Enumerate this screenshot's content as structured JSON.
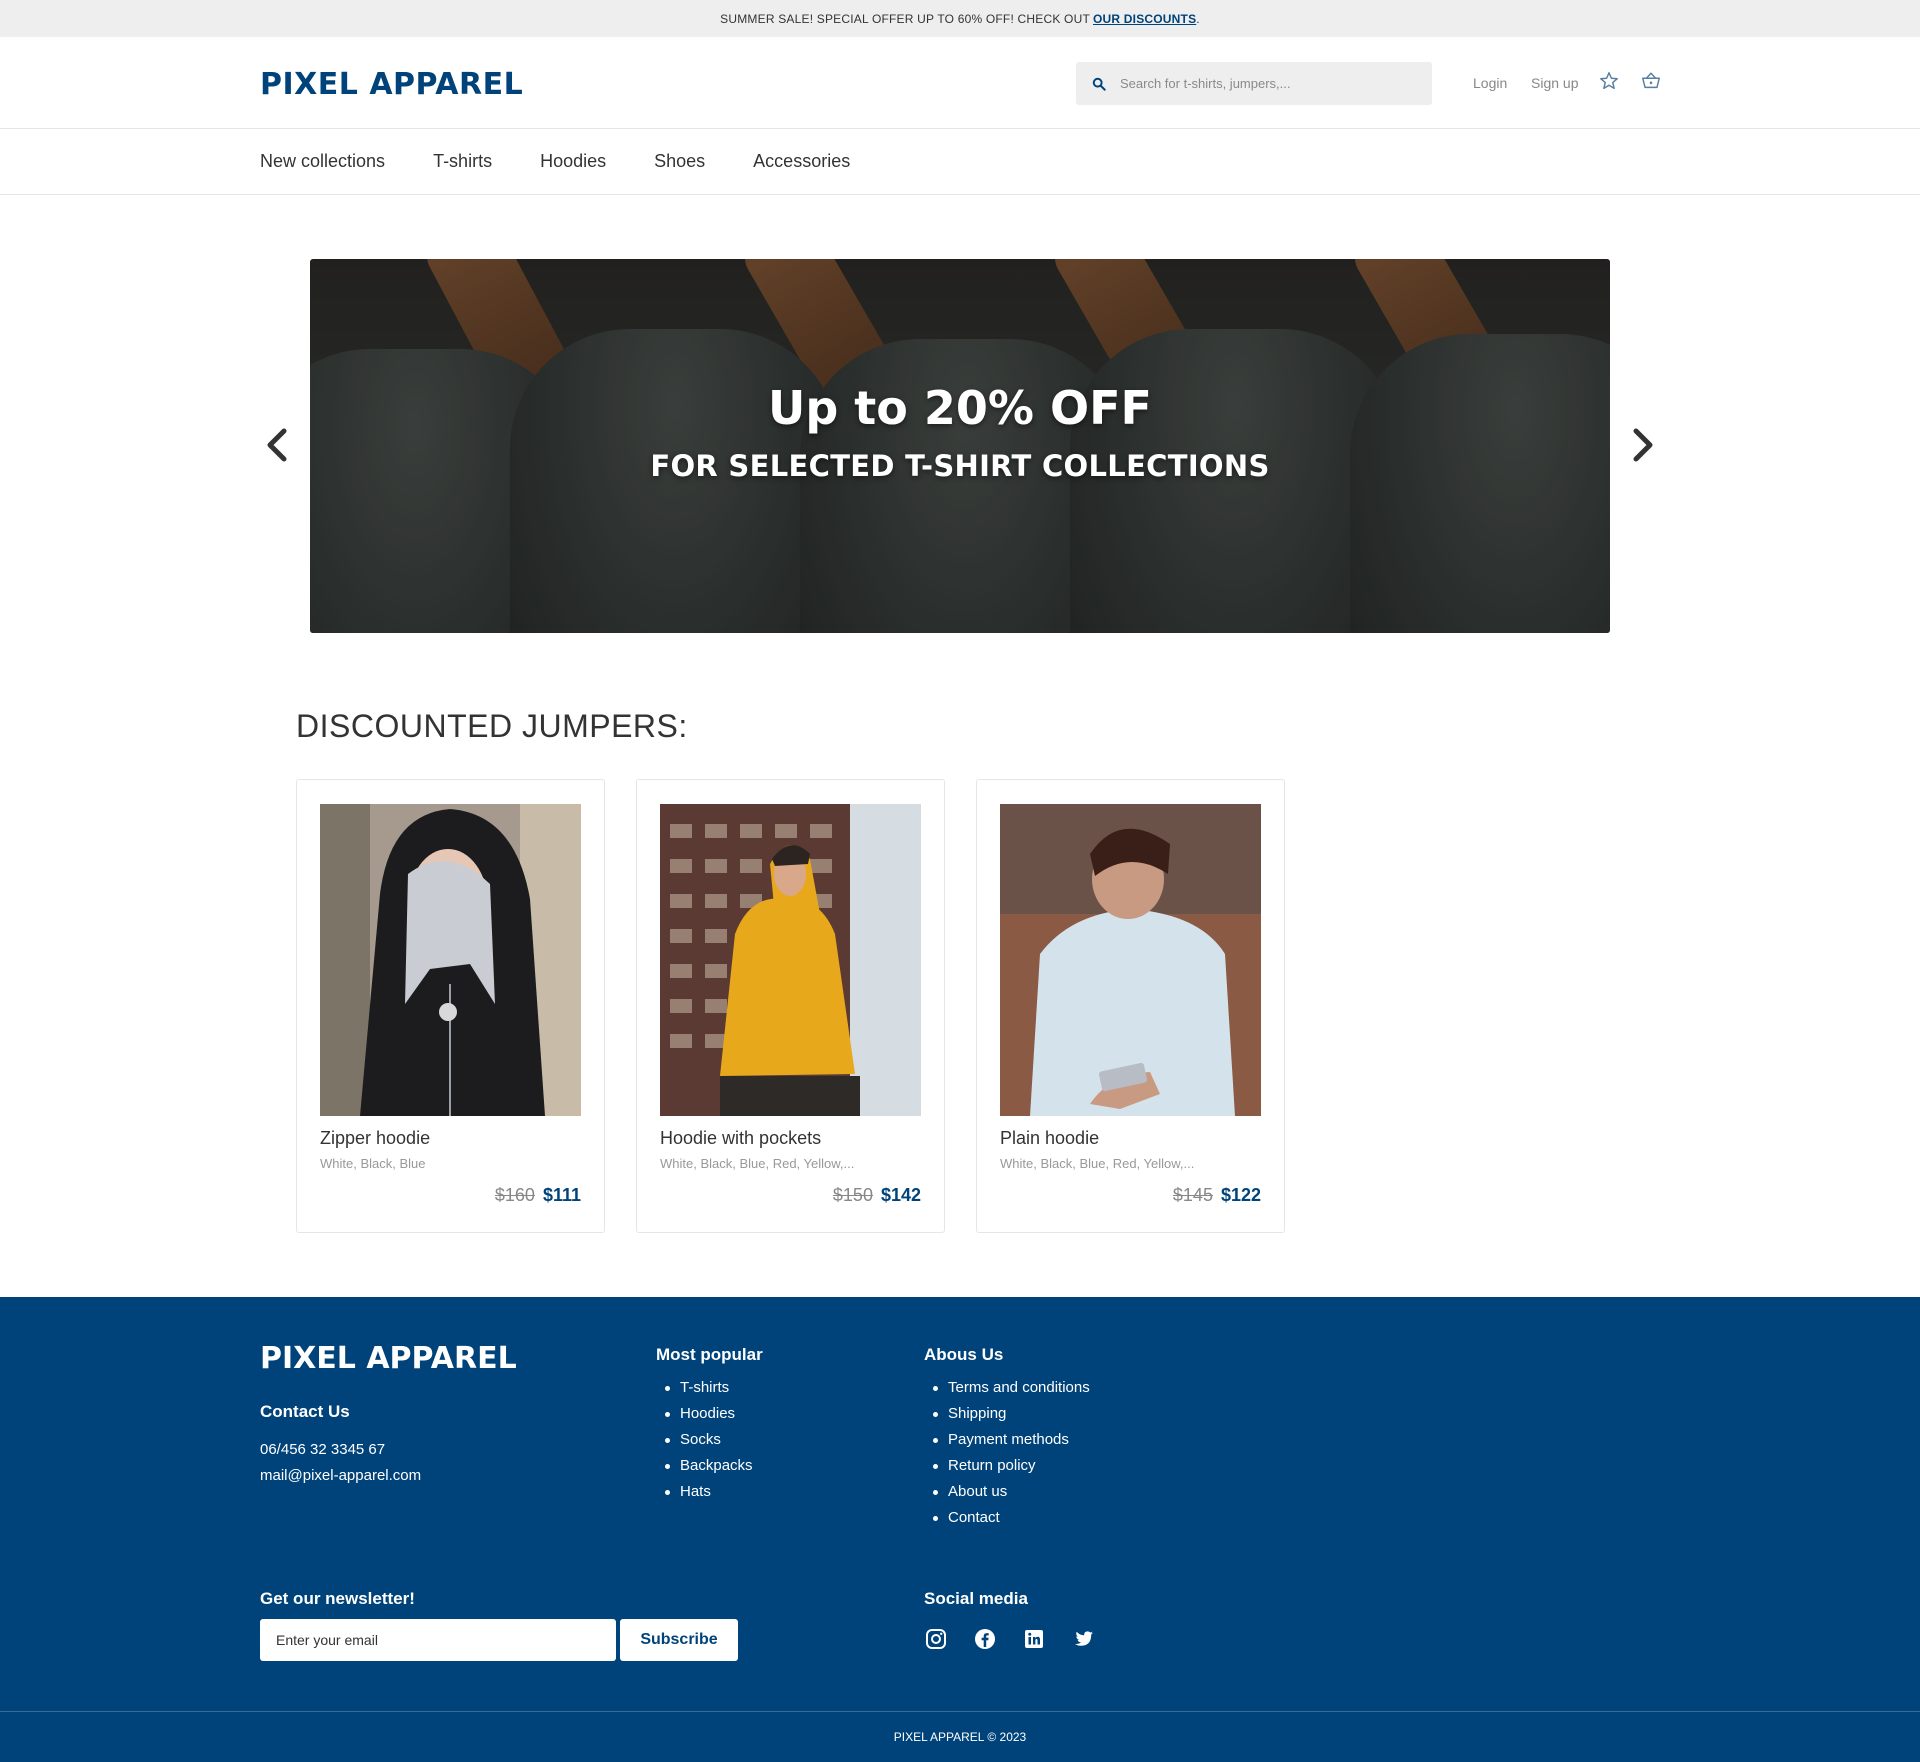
{
  "topbar": {
    "text": "SUMMER SALE! SPECIAL OFFER UP TO 60% OFF! CHECK OUT",
    "link": "OUR DISCOUNTS",
    "suffix": "."
  },
  "header": {
    "logo": "PIXEL APPAREL",
    "search_placeholder": "Search for t-shirts, jumpers,...",
    "login": "Login",
    "signup": "Sign up"
  },
  "nav": {
    "items": [
      "New collections",
      "T-shirts",
      "Hoodies",
      "Shoes",
      "Accessories"
    ]
  },
  "hero": {
    "title": "Up to 20% OFF",
    "subtitle": "FOR SELECTED T-SHIRT COLLECTIONS"
  },
  "discounted": {
    "title": "DISCOUNTED JUMPERS:",
    "products": [
      {
        "name": "Zipper hoodie",
        "colors": "White, Black, Blue",
        "old_price": "$160",
        "new_price": "$111"
      },
      {
        "name": "Hoodie with pockets",
        "colors": "White, Black, Blue, Red, Yellow,...",
        "old_price": "$150",
        "new_price": "$142"
      },
      {
        "name": "Plain hoodie",
        "colors": "White, Black, Blue, Red, Yellow,...",
        "old_price": "$145",
        "new_price": "$122"
      }
    ]
  },
  "footer": {
    "logo": "PIXEL APPAREL",
    "contact_heading": "Contact Us",
    "phone": "06/456 32 3345 67",
    "email": "mail@pixel-apparel.com",
    "popular_heading": "Most popular",
    "popular": [
      "T-shirts",
      "Hoodies",
      "Socks",
      "Backpacks",
      "Hats"
    ],
    "about_heading": "Abous Us",
    "about": [
      "Terms and conditions",
      "Shipping",
      "Payment methods",
      "Return policy",
      "About us",
      "Contact"
    ],
    "newsletter_heading": "Get our newsletter!",
    "newsletter_placeholder": "Enter your email",
    "subscribe": "Subscribe",
    "social_heading": "Social media",
    "social_icons": [
      "instagram-icon",
      "facebook-icon",
      "linkedin-icon",
      "twitter-icon"
    ],
    "copyright": "PIXEL APPAREL © 2023"
  },
  "colors": {
    "brand": "#00437a",
    "topbar_bg": "#eeeeee"
  }
}
